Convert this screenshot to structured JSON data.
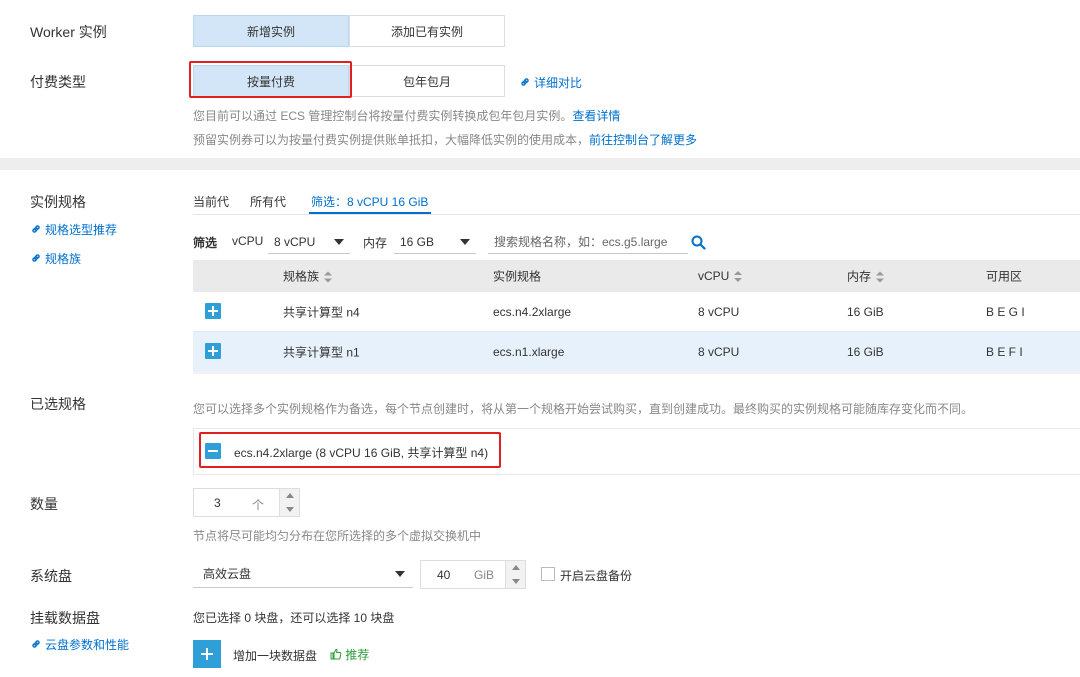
{
  "worker": {
    "label": "Worker 实例",
    "options": [
      "新增实例",
      "添加已有实例"
    ]
  },
  "billing": {
    "label": "付费类型",
    "options": [
      "按量付费",
      "包年包月"
    ],
    "compare_link": "详细对比",
    "note1": "您目前可以通过 ECS 管理控制台将按量付费实例转换成包年包月实例。",
    "note1_link": "查看详情",
    "note2": "预留实例券可以为按量付费实例提供账单抵扣，大幅降低实例的使用成本，",
    "note2_link": "前往控制台了解更多"
  },
  "spec": {
    "label": "实例规格",
    "link_recommend": "规格选型推荐",
    "link_family": "规格族",
    "tabs": [
      "当前代",
      "所有代"
    ],
    "filter_tab": "筛选：8 vCPU 16 GiB",
    "filter_label": "筛选",
    "vcpu_label": "vCPU",
    "vcpu_value": "8 vCPU",
    "mem_label": "内存",
    "mem_value": "16 GB",
    "search_placeholder": "搜索规格名称，如：ecs.g5.large",
    "columns": [
      "规格族",
      "实例规格",
      "vCPU",
      "内存",
      "可用区"
    ],
    "rows": [
      {
        "family": "共享计算型 n4",
        "type": "ecs.n4.2xlarge",
        "vcpu": "8 vCPU",
        "mem": "16 GiB",
        "zone": "B E G I"
      },
      {
        "family": "共享计算型 n1",
        "type": "ecs.n1.xlarge",
        "vcpu": "8 vCPU",
        "mem": "16 GiB",
        "zone": "B E F I"
      }
    ]
  },
  "selected": {
    "label": "已选规格",
    "note": "您可以选择多个实例规格作为备选，每个节点创建时，将从第一个规格开始尝试购买，直到创建成功。最终购买的实例规格可能随库存变化而不同。",
    "item": "ecs.n4.2xlarge (8 vCPU 16 GiB, 共享计算型 n4)"
  },
  "quantity": {
    "label": "数量",
    "value": "3",
    "unit": "个",
    "note": "节点将尽可能均匀分布在您所选择的多个虚拟交换机中"
  },
  "system_disk": {
    "label": "系统盘",
    "type": "高效云盘",
    "size": "40",
    "unit": "GiB",
    "backup_label": "开启云盘备份"
  },
  "data_disk": {
    "label": "挂载数据盘",
    "link": "云盘参数和性能",
    "note": "您已选择 0 块盘，还可以选择 10 块盘",
    "add_label": "增加一块数据盘",
    "recommend": "推荐"
  }
}
